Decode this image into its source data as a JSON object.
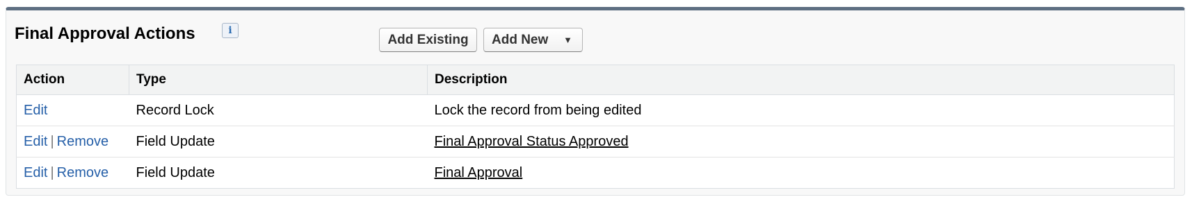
{
  "section": {
    "title": "Final Approval Actions",
    "info_icon_glyph": "i",
    "info_icon": "info-icon"
  },
  "buttons": {
    "add_existing": "Add Existing",
    "add_new": "Add New",
    "add_new_caret": "▼"
  },
  "table": {
    "headers": [
      "Action",
      "Type",
      "Description"
    ],
    "separator": "|",
    "rows": [
      {
        "edit": "Edit",
        "remove": "",
        "type": "Record Lock",
        "description": "Lock the record from being edited",
        "description_is_link": false
      },
      {
        "edit": "Edit",
        "remove": "Remove",
        "type": "Field Update",
        "description": "Final Approval Status Approved",
        "description_is_link": true
      },
      {
        "edit": "Edit",
        "remove": "Remove",
        "type": "Field Update",
        "description": "Final Approval",
        "description_is_link": true
      }
    ]
  },
  "colors": {
    "header_bar": "#5e6f82",
    "link": "#255fa8"
  }
}
